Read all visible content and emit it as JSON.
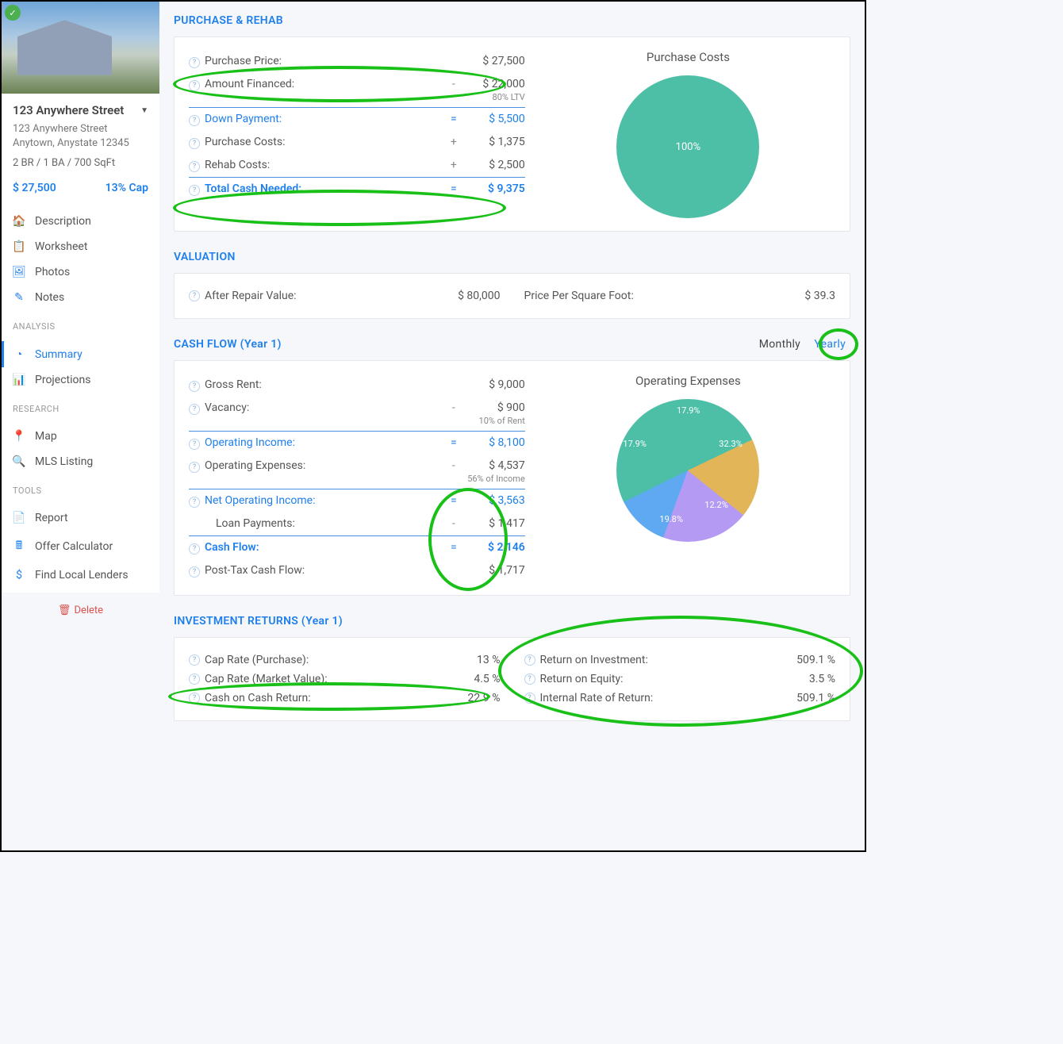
{
  "sidebar": {
    "title": "123 Anywhere Street",
    "address_line1": "123 Anywhere Street",
    "address_line2": "Anytown, Anystate 12345",
    "meta": "2 BR  /  1 BA  /  700 SqFt",
    "price": "$ 27,500",
    "cap": "13% Cap",
    "items": [
      "Description",
      "Worksheet",
      "Photos",
      "Notes"
    ],
    "analysis_label": "ANALYSIS",
    "analysis": [
      "Summary",
      "Projections"
    ],
    "research_label": "RESEARCH",
    "research": [
      "Map",
      "MLS Listing"
    ],
    "tools_label": "TOOLS",
    "tools": [
      "Report",
      "Offer Calculator",
      "Find Local Lenders"
    ],
    "delete": "Delete"
  },
  "purchase": {
    "title": "PURCHASE & REHAB",
    "chart_title": "Purchase Costs",
    "chart_center": "100%",
    "rows": {
      "purchase_price": {
        "label": "Purchase Price:",
        "op": "",
        "val": "$ 27,500"
      },
      "amount_financed": {
        "label": "Amount Financed:",
        "op": "-",
        "val": "$ 22,000",
        "sub": "80% LTV"
      },
      "down_payment": {
        "label": "Down Payment:",
        "op": "=",
        "val": "$ 5,500"
      },
      "purchase_costs": {
        "label": "Purchase Costs:",
        "op": "+",
        "val": "$ 1,375"
      },
      "rehab_costs": {
        "label": "Rehab Costs:",
        "op": "+",
        "val": "$ 2,500"
      },
      "total_cash": {
        "label": "Total Cash Needed:",
        "op": "=",
        "val": "$ 9,375"
      }
    }
  },
  "valuation": {
    "title": "VALUATION",
    "arv_label": "After Repair Value:",
    "arv_val": "$ 80,000",
    "ppsf_label": "Price Per Square Foot:",
    "ppsf_val": "$ 39.3"
  },
  "cashflow": {
    "title": "CASH FLOW  (Year 1)",
    "toggle_monthly": "Monthly",
    "toggle_yearly": "Yearly",
    "chart_title": "Operating Expenses",
    "rows": {
      "gross_rent": {
        "label": "Gross Rent:",
        "op": "",
        "val": "$ 9,000"
      },
      "vacancy": {
        "label": "Vacancy:",
        "op": "-",
        "val": "$ 900",
        "sub": "10% of Rent"
      },
      "operating_income": {
        "label": "Operating Income:",
        "op": "=",
        "val": "$ 8,100"
      },
      "operating_expenses": {
        "label": "Operating Expenses:",
        "op": "-",
        "val": "$ 4,537",
        "sub": "56% of Income"
      },
      "net_operating": {
        "label": "Net Operating Income:",
        "op": "=",
        "val": "$ 3,563"
      },
      "loan_payments": {
        "label": "Loan Payments:",
        "op": "-",
        "val": "$ 1,417"
      },
      "cash_flow": {
        "label": "Cash Flow:",
        "op": "=",
        "val": "$ 2,146"
      },
      "post_tax": {
        "label": "Post-Tax Cash Flow:",
        "op": "",
        "val": "$ 1,717"
      }
    }
  },
  "returns": {
    "title": "INVESTMENT RETURNS  (Year 1)",
    "left": {
      "cap_purchase": {
        "label": "Cap Rate (Purchase):",
        "val": "13 %"
      },
      "cap_market": {
        "label": "Cap Rate (Market Value):",
        "val": "4.5 %"
      },
      "cash_on_cash": {
        "label": "Cash on Cash Return:",
        "val": "22.9 %"
      }
    },
    "right": {
      "roi": {
        "label": "Return on Investment:",
        "val": "509.1 %"
      },
      "roe": {
        "label": "Return on Equity:",
        "val": "3.5 %"
      },
      "irr": {
        "label": "Internal Rate of Return:",
        "val": "509.1 %"
      }
    }
  },
  "chart_data": [
    {
      "type": "pie",
      "title": "Purchase Costs",
      "series": [
        {
          "name": "Purchase Costs",
          "value": 100
        }
      ],
      "labels": [
        "100%"
      ]
    },
    {
      "type": "pie",
      "title": "Operating Expenses",
      "slices": [
        {
          "value": 17.9
        },
        {
          "value": 17.9
        },
        {
          "value": 19.8
        },
        {
          "value": 12.2
        },
        {
          "value": 32.3
        }
      ]
    }
  ]
}
